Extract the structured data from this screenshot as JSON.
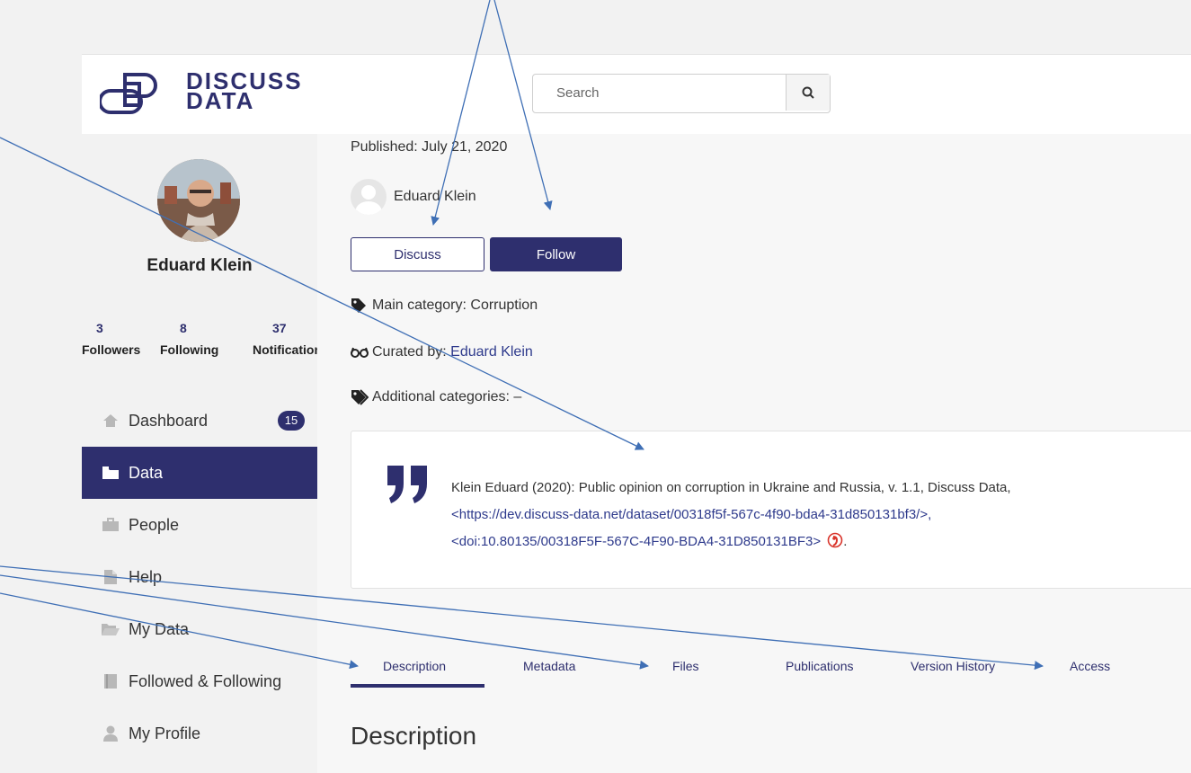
{
  "header": {
    "logo_line1": "DISCUSS",
    "logo_line2": "DATA",
    "search_placeholder": "Search"
  },
  "profile": {
    "name": "Eduard Klein",
    "stats": [
      {
        "count": "3",
        "label": "Followers"
      },
      {
        "count": "8",
        "label": "Following"
      },
      {
        "count": "37",
        "label": "Notifications"
      }
    ]
  },
  "sidebar": {
    "items": [
      {
        "label": "Dashboard",
        "icon": "home-icon",
        "badge": "15"
      },
      {
        "label": "Data",
        "icon": "folder-icon",
        "active": true
      },
      {
        "label": "People",
        "icon": "briefcase-icon"
      },
      {
        "label": "Help",
        "icon": "file-icon"
      },
      {
        "label": "My Data",
        "icon": "folder-open-icon"
      },
      {
        "label": "Followed & Following",
        "icon": "book-icon"
      },
      {
        "label": "My Profile",
        "icon": "user-icon"
      }
    ]
  },
  "dataset": {
    "published": "Published: July 21, 2020",
    "author": "Eduard Klein",
    "discuss_label": "Discuss",
    "follow_label": "Follow",
    "main_category": "Main category: Corruption",
    "curated_prefix": "Curated by: ",
    "curated_by": "Eduard Klein",
    "additional_categories": "Additional categories: –",
    "citation_line1": "Klein Eduard (2020): Public opinion on corruption in Ukraine and Russia, v. 1.1, Discuss Data,",
    "citation_line2": "<https://dev.discuss-data.net/dataset/00318f5f-567c-4f90-bda4-31d850131bf3/>,",
    "citation_line3": "<doi:10.80135/00318F5F-567C-4F90-BDA4-31D850131BF3>",
    "citation_end": "."
  },
  "tabs": [
    "Description",
    "Metadata",
    "Files",
    "Publications",
    "Version History",
    "Access"
  ],
  "section_heading": "Description",
  "colors": {
    "brand": "#2e2f6e",
    "link": "#2e3a8c",
    "annotation": "#3f6fb5",
    "doi_icon": "#d9342b"
  }
}
